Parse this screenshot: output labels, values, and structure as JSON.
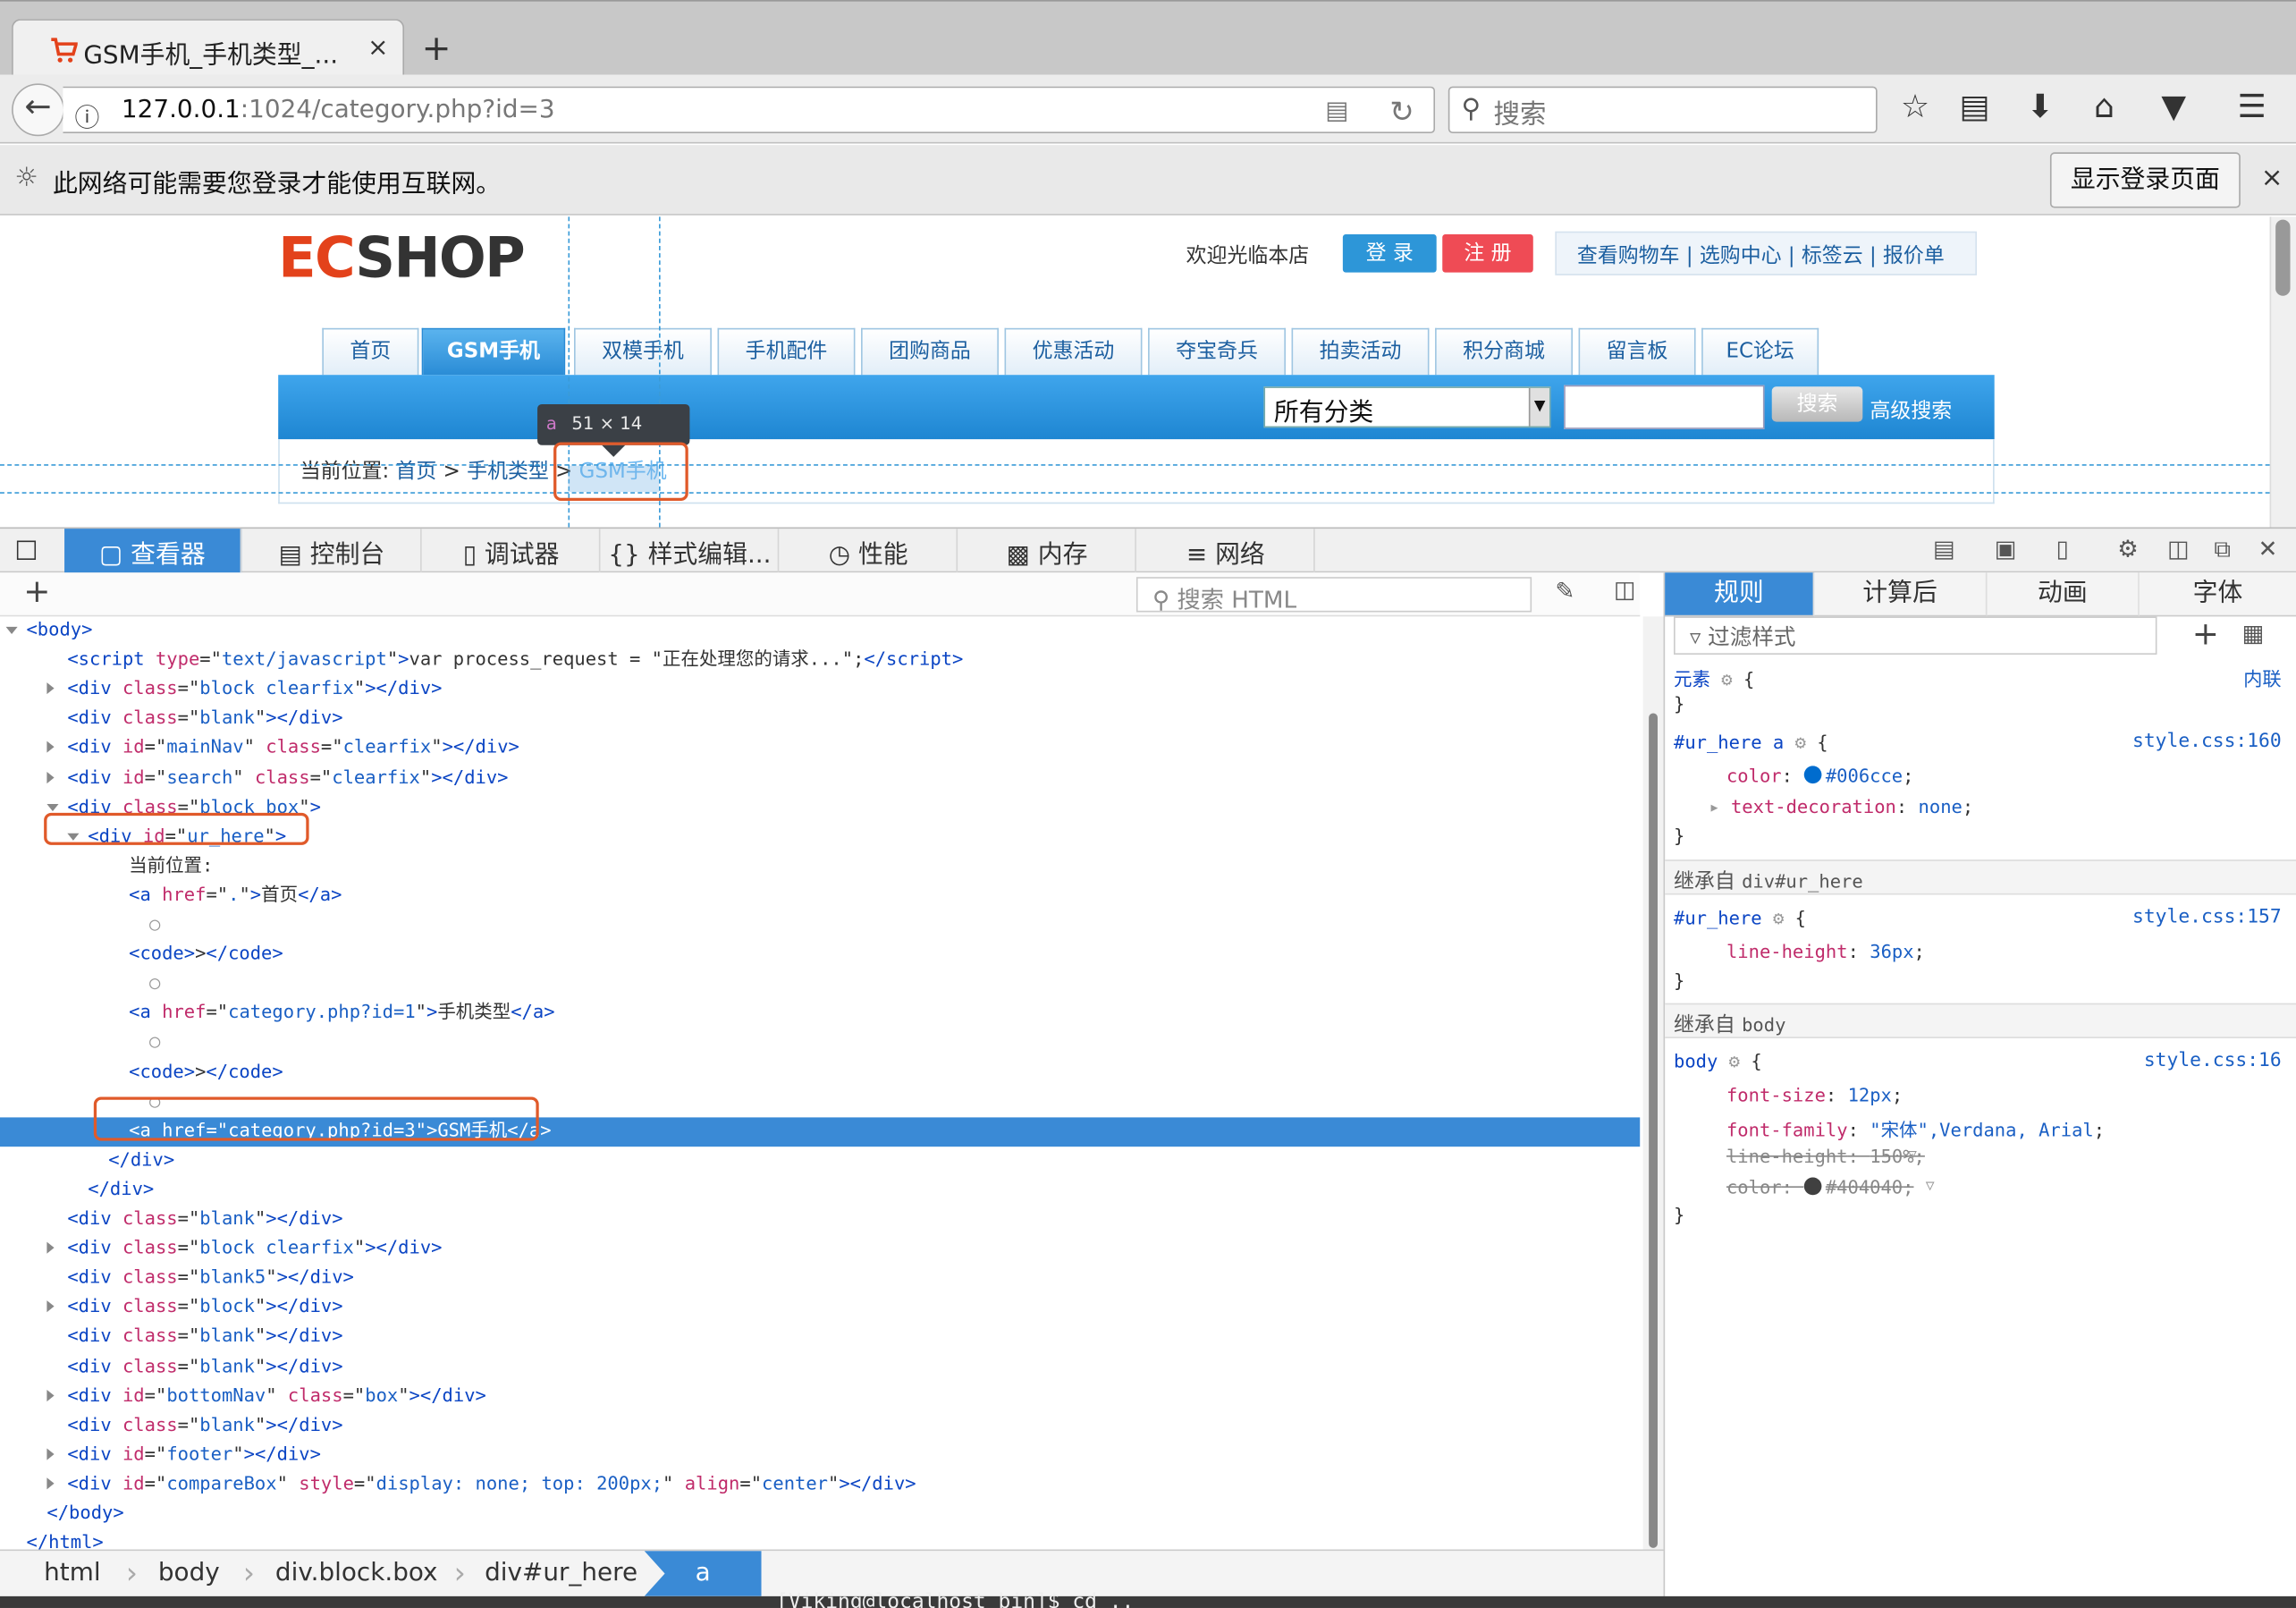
{
  "browser": {
    "tab_title": "GSM手机_手机类型_...",
    "tab_close": "×",
    "new_tab": "+",
    "url_host": "127.0.0.1",
    "url_rest": ":1024/category.php?id=3",
    "search_placeholder": "搜索"
  },
  "notification": {
    "message": "此网络可能需要您登录才能使用互联网。",
    "button": "显示登录页面",
    "close": "×"
  },
  "page": {
    "logo_e": "EC",
    "logo_rest": "SHOP",
    "welcome": "欢迎光临本店",
    "login": "登 录",
    "register": "注 册",
    "toplinks": "查看购物车 | 选购中心 | 标签云 | 报价单",
    "nav": [
      "首页",
      "GSM手机",
      "双模手机",
      "手机配件",
      "团购商品",
      "优惠活动",
      "夺宝奇兵",
      "拍卖活动",
      "积分商城",
      "留言板",
      "EC论坛"
    ],
    "category_select": "所有分类",
    "search_button": "搜索",
    "advanced_search": "高级搜索",
    "breadcrumb_label": "当前位置:",
    "breadcrumb_home": "首页",
    "breadcrumb_type": "手机类型",
    "breadcrumb_current": "GSM手机",
    "gt": ">"
  },
  "highlighter": {
    "tag": "a",
    "size": "51 × 14"
  },
  "devtools": {
    "tabs": [
      "查看器",
      "控制台",
      "调试器",
      "样式编辑...",
      "性能",
      "内存",
      "网络"
    ],
    "tab_icons": [
      "inspector-icon",
      "console-icon",
      "debugger-icon",
      "style-editor-icon",
      "performance-icon",
      "memory-icon",
      "network-icon"
    ],
    "search_html_placeholder": "搜索 HTML",
    "markup": [
      {
        "indent": 0,
        "tw": "open",
        "html": "<span class=\"tg\">&lt;body&gt;</span>"
      },
      {
        "indent": 2,
        "tw": "",
        "html": "<span class=\"tg\">&lt;script</span> <span class=\"at\">type</span>=\"<span class=\"av\">text/javascript</span>\"<span class=\"tg\">&gt;</span>var process_request = \"正在处理您的请求...\";<span class=\"tg\">&lt;/script&gt;</span>"
      },
      {
        "indent": 2,
        "tw": "closed",
        "html": "<span class=\"tg\">&lt;div</span> <span class=\"at\">class</span>=\"<span class=\"av\">block clearfix</span>\"<span class=\"tg\">&gt;&lt;/div&gt;</span>"
      },
      {
        "indent": 2,
        "tw": "",
        "html": "<span class=\"tg\">&lt;div</span> <span class=\"at\">class</span>=\"<span class=\"av\">blank</span>\"<span class=\"tg\">&gt;&lt;/div&gt;</span>"
      },
      {
        "indent": 2,
        "tw": "closed",
        "html": "<span class=\"tg\">&lt;div</span> <span class=\"at\">id</span>=\"<span class=\"av\">mainNav</span>\" <span class=\"at\">class</span>=\"<span class=\"av\">clearfix</span>\"<span class=\"tg\">&gt;&lt;/div&gt;</span>"
      },
      {
        "indent": 2,
        "tw": "closed",
        "html": "<span class=\"tg\">&lt;div</span> <span class=\"at\">id</span>=\"<span class=\"av\">search</span>\" <span class=\"at\">class</span>=\"<span class=\"av\">clearfix</span>\"<span class=\"tg\">&gt;&lt;/div&gt;</span>"
      },
      {
        "indent": 2,
        "tw": "open",
        "html": "<span class=\"tg\">&lt;div</span> <span class=\"at\">class</span>=\"<span class=\"av\">block box</span>\"<span class=\"tg\">&gt;</span>"
      },
      {
        "indent": 3,
        "tw": "open",
        "html": "<span class=\"tg\">&lt;div</span> <span class=\"at\">id</span>=\"<span class=\"av\">ur_here</span>\"<span class=\"tg\">&gt;</span>"
      },
      {
        "indent": 5,
        "tw": "",
        "html": "当前位置:"
      },
      {
        "indent": 5,
        "tw": "",
        "html": "<span class=\"tg\">&lt;a</span> <span class=\"at\">href</span>=\"<span class=\"av\">.</span>\"<span class=\"tg\">&gt;</span>首页<span class=\"tg\">&lt;/a&gt;</span>"
      },
      {
        "indent": 6,
        "tw": "",
        "html": "<span class=\"gr\">○</span>"
      },
      {
        "indent": 5,
        "tw": "",
        "html": "<span class=\"tg\">&lt;code&gt;</span>&gt;<span class=\"tg\">&lt;/code&gt;</span>"
      },
      {
        "indent": 6,
        "tw": "",
        "html": "<span class=\"gr\">○</span>"
      },
      {
        "indent": 5,
        "tw": "",
        "html": "<span class=\"tg\">&lt;a</span> <span class=\"at\">href</span>=\"<span class=\"av\">category.php?id=1</span>\"<span class=\"tg\">&gt;</span>手机类型<span class=\"tg\">&lt;/a&gt;</span>"
      },
      {
        "indent": 6,
        "tw": "",
        "html": "<span class=\"gr\">○</span>"
      },
      {
        "indent": 5,
        "tw": "",
        "html": "<span class=\"tg\">&lt;code&gt;</span>&gt;<span class=\"tg\">&lt;/code&gt;</span>"
      },
      {
        "indent": 6,
        "tw": "",
        "html": "<span class=\"gr\">○</span>"
      },
      {
        "indent": 5,
        "tw": "",
        "sel": true,
        "html": "<span class=\"tg\">&lt;a</span> <span class=\"at\">href</span>=\"<span class=\"av\">category.php?id=3</span>\"<span class=\"tg\">&gt;</span>GSM手机<span class=\"tg\">&lt;/a&gt;</span>"
      },
      {
        "indent": 4,
        "tw": "",
        "html": "<span class=\"tg\">&lt;/div&gt;</span>"
      },
      {
        "indent": 3,
        "tw": "",
        "html": "<span class=\"tg\">&lt;/div&gt;</span>"
      },
      {
        "indent": 2,
        "tw": "",
        "html": "<span class=\"tg\">&lt;div</span> <span class=\"at\">class</span>=\"<span class=\"av\">blank</span>\"<span class=\"tg\">&gt;&lt;/div&gt;</span>"
      },
      {
        "indent": 2,
        "tw": "closed",
        "html": "<span class=\"tg\">&lt;div</span> <span class=\"at\">class</span>=\"<span class=\"av\">block clearfix</span>\"<span class=\"tg\">&gt;&lt;/div&gt;</span>"
      },
      {
        "indent": 2,
        "tw": "",
        "html": "<span class=\"tg\">&lt;div</span> <span class=\"at\">class</span>=\"<span class=\"av\">blank5</span>\"<span class=\"tg\">&gt;&lt;/div&gt;</span>"
      },
      {
        "indent": 2,
        "tw": "closed",
        "html": "<span class=\"tg\">&lt;div</span> <span class=\"at\">class</span>=\"<span class=\"av\">block</span>\"<span class=\"tg\">&gt;&lt;/div&gt;</span>"
      },
      {
        "indent": 2,
        "tw": "",
        "html": "<span class=\"tg\">&lt;div</span> <span class=\"at\">class</span>=\"<span class=\"av\">blank</span>\"<span class=\"tg\">&gt;&lt;/div&gt;</span>"
      },
      {
        "indent": 2,
        "tw": "",
        "html": "<span class=\"tg\">&lt;div</span> <span class=\"at\">class</span>=\"<span class=\"av\">blank</span>\"<span class=\"tg\">&gt;&lt;/div&gt;</span>"
      },
      {
        "indent": 2,
        "tw": "closed",
        "html": "<span class=\"tg\">&lt;div</span> <span class=\"at\">id</span>=\"<span class=\"av\">bottomNav</span>\" <span class=\"at\">class</span>=\"<span class=\"av\">box</span>\"<span class=\"tg\">&gt;&lt;/div&gt;</span>"
      },
      {
        "indent": 2,
        "tw": "",
        "html": "<span class=\"tg\">&lt;div</span> <span class=\"at\">class</span>=\"<span class=\"av\">blank</span>\"<span class=\"tg\">&gt;&lt;/div&gt;</span>"
      },
      {
        "indent": 2,
        "tw": "closed",
        "html": "<span class=\"tg\">&lt;div</span> <span class=\"at\">id</span>=\"<span class=\"av\">footer</span>\"<span class=\"tg\">&gt;&lt;/div&gt;</span>"
      },
      {
        "indent": 2,
        "tw": "closed",
        "html": "<span class=\"tg\">&lt;div</span> <span class=\"at\">id</span>=\"<span class=\"av\">compareBox</span>\" <span class=\"at\">style</span>=\"<span class=\"av\">display: none; top: 200px;</span>\" <span class=\"at\">align</span>=\"<span class=\"av\">center</span>\"<span class=\"tg\">&gt;&lt;/div&gt;</span>"
      },
      {
        "indent": 1,
        "tw": "",
        "html": "<span class=\"tg\">&lt;/body&gt;</span>"
      },
      {
        "indent": 0,
        "tw": "",
        "html": "<span class=\"tg\">&lt;/html&gt;</span>"
      }
    ],
    "breadcrumbs": [
      "html",
      "body",
      "div.block.box",
      "div#ur_here",
      "a"
    ],
    "rules_tabs": [
      "规则",
      "计算后",
      "动画",
      "字体"
    ],
    "filter_placeholder": "过滤样式",
    "rules": {
      "element_selector": "元素",
      "element_source": "内联",
      "rule1_selector": "#ur_here a",
      "rule1_source": "style.css:160",
      "rule1_color_prop": "color",
      "rule1_color_val": "#006cce",
      "rule1_td_prop": "text-decoration",
      "rule1_td_val": "none",
      "inherit1_label": "继承自",
      "inherit1_sel": "div#ur_here",
      "rule2_selector": "#ur_here",
      "rule2_source": "style.css:157",
      "rule2_lh_prop": "line-height",
      "rule2_lh_val": "36px",
      "inherit2_label": "继承自",
      "inherit2_sel": "body",
      "rule3_selector": "body",
      "rule3_source": "style.css:16",
      "rule3_fs_prop": "font-size",
      "rule3_fs_val": "12px",
      "rule3_ff_prop": "font-family",
      "rule3_ff_val": "\"宋体\",Verdana, Arial",
      "rule3_lh_prop": "line-height",
      "rule3_lh_val": "150%",
      "rule3_c_prop": "color",
      "rule3_c_val": "#404040",
      "open_brace": "{",
      "close_brace": "}"
    }
  },
  "terminal_text": "[Viking@localhost bin]$ cd ..",
  "colors": {
    "accent": "#3a8ad6",
    "link": "#006cce",
    "highlight_box": "#e05a2a",
    "body_text": "#404040"
  }
}
